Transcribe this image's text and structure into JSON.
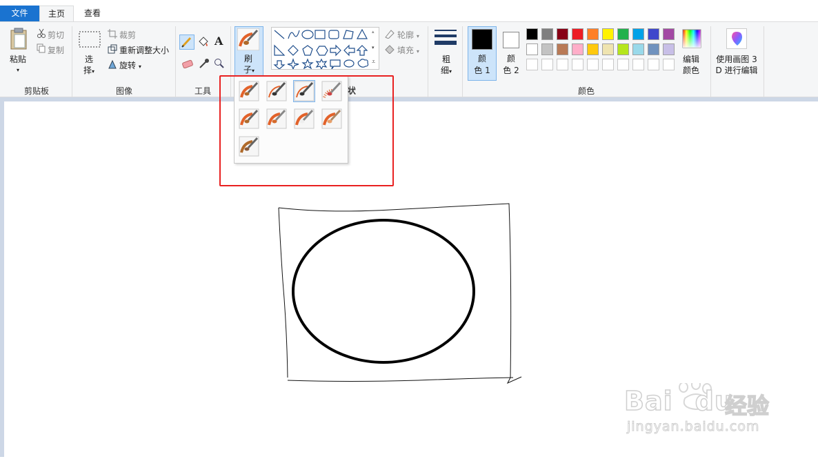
{
  "tabs": {
    "file": "文件",
    "home": "主页",
    "view": "查看"
  },
  "clipboard": {
    "paste": "粘贴",
    "cut": "剪切",
    "copy": "复制",
    "group": "剪贴板"
  },
  "image": {
    "select_top": "选",
    "select_bottom": "择",
    "crop": "裁剪",
    "resize": "重新调整大小",
    "rotate": "旋转",
    "group": "图像"
  },
  "tools": {
    "group": "工具"
  },
  "brushes": {
    "label_top": "刷",
    "label_bottom": "子"
  },
  "shapes": {
    "outline": "轮廓",
    "fill": "填充",
    "group_tail": "状"
  },
  "size": {
    "label_top": "粗",
    "label_bottom": "细"
  },
  "colors": {
    "color1_top": "颜",
    "color1_bottom": "色 1",
    "color2_top": "颜",
    "color2_bottom": "色 2",
    "edit_top": "编辑",
    "edit_bottom": "颜色",
    "group": "颜色",
    "row1": [
      "#000000",
      "#7f7f7f",
      "#880015",
      "#ed1c24",
      "#ff7f27",
      "#fff200",
      "#22b14c",
      "#00a2e8",
      "#3f48cc",
      "#a349a4"
    ],
    "row2": [
      "#ffffff",
      "#c3c3c3",
      "#b97a57",
      "#ffaec9",
      "#ffc90e",
      "#efe4b0",
      "#b5e61d",
      "#99d9ea",
      "#7092be",
      "#c8bfe7"
    ],
    "row3": [
      "#ffffff",
      "#ffffff",
      "#ffffff",
      "#ffffff",
      "#ffffff",
      "#ffffff",
      "#ffffff",
      "#ffffff",
      "#ffffff",
      "#ffffff"
    ]
  },
  "paint3d": {
    "line1": "使用画图 3",
    "line2": "D 进行编辑"
  },
  "watermark": {
    "brand": "Bai",
    "brand2": "du",
    "cn": "经验",
    "url": "jingyan.baidu.com"
  }
}
